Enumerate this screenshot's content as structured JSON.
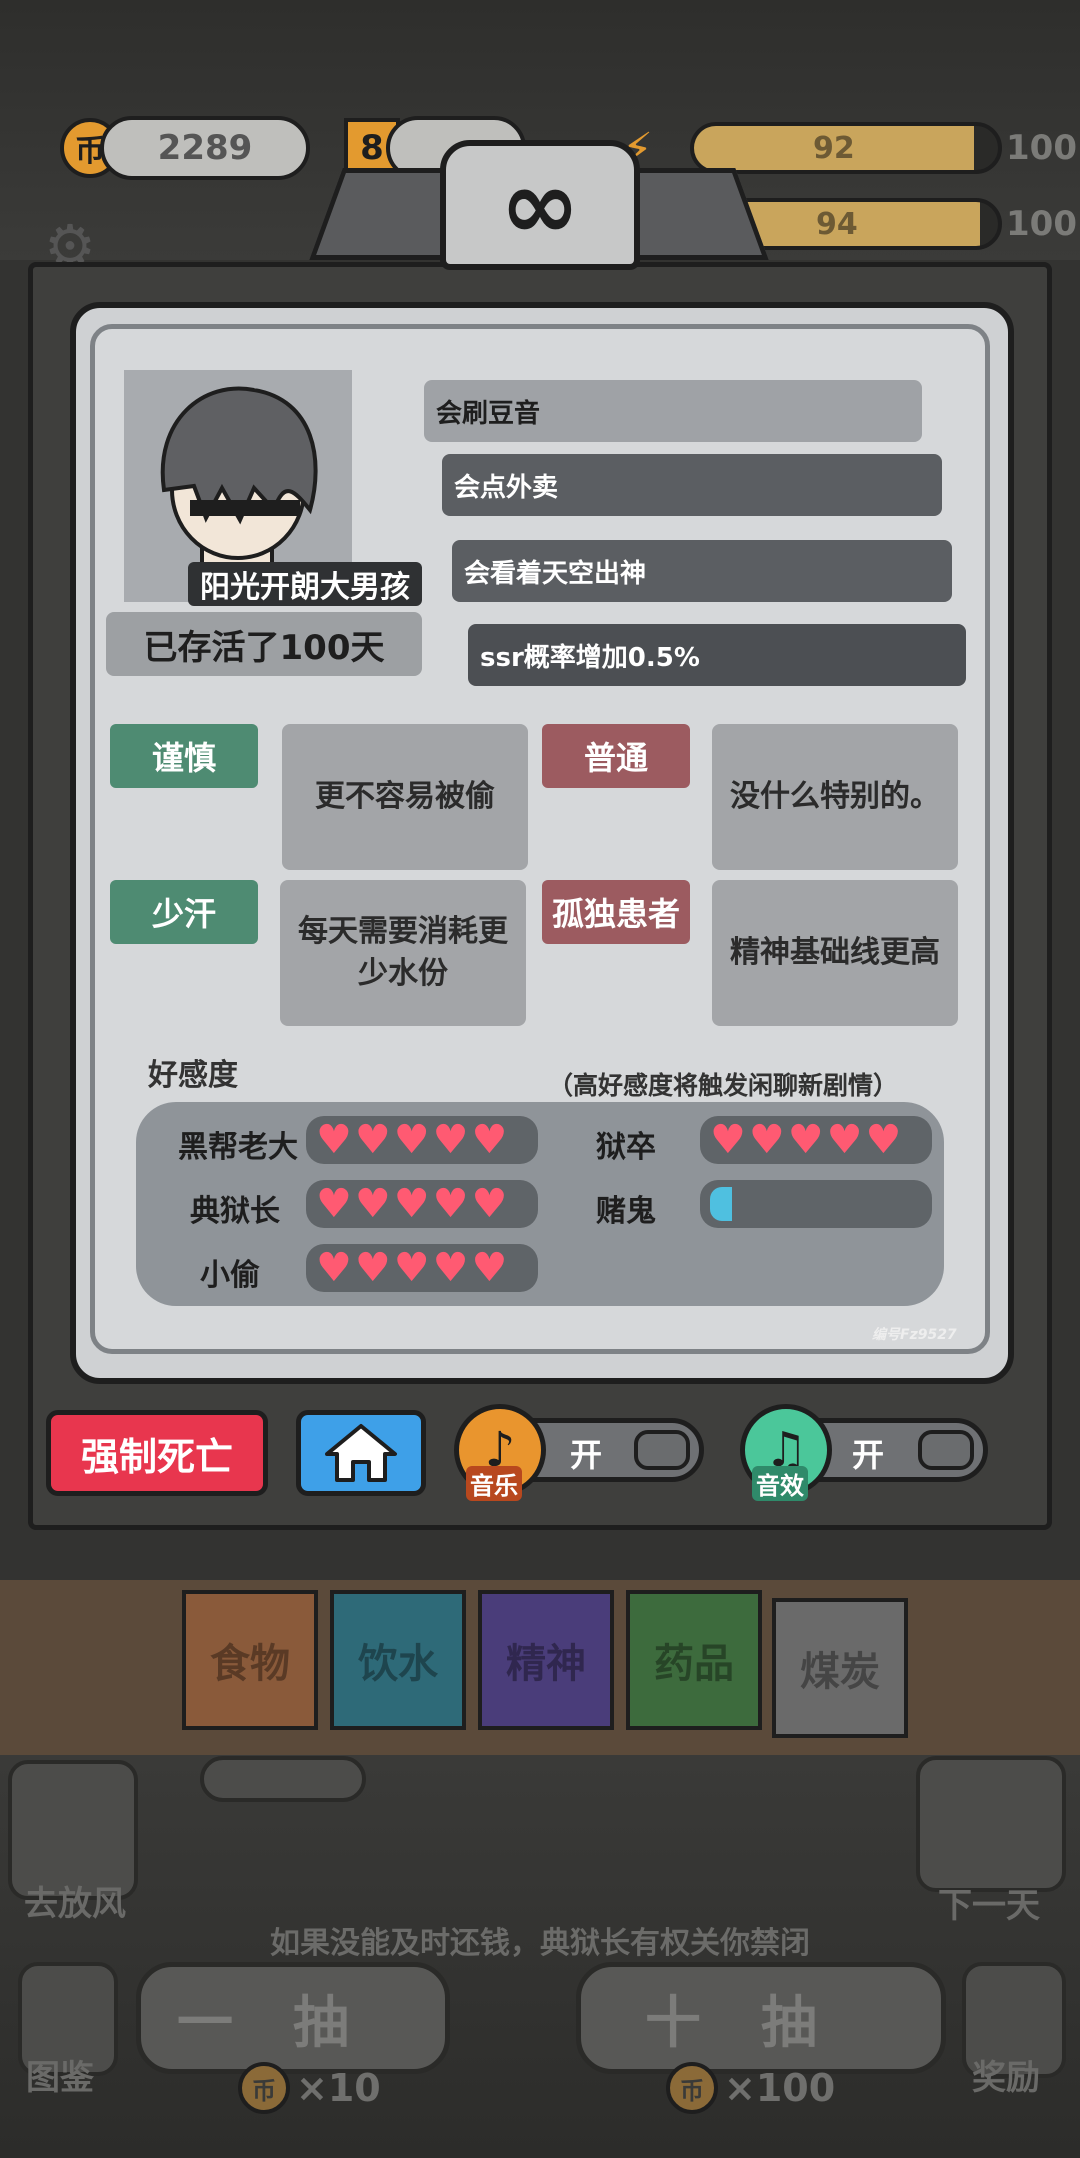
{
  "resources": {
    "coins": "2289",
    "s_value": "8",
    "energy": "92",
    "energy_max": "100",
    "water": "94",
    "water_max": "100",
    "coin_glyph": "币",
    "s_glyph": "S"
  },
  "profile": {
    "name": "阳光开朗大男孩",
    "days_alive": "已存活了100天",
    "taglines": [
      "会刷豆音",
      "会点外卖",
      "会看着天空出神",
      "ssr概率增加0.5%"
    ]
  },
  "traits": [
    {
      "label": "谨慎",
      "desc": "更不容易被偷",
      "color": "#4e8b72"
    },
    {
      "label": "普通",
      "desc": "没什么特别的。",
      "color": "#9c5b60"
    },
    {
      "label": "少汗",
      "desc": "每天需要消耗更少水份",
      "color": "#4e8b72"
    },
    {
      "label": "孤独患者",
      "desc": "精神基础线更高",
      "color": "#9c5b60"
    }
  ],
  "affection": {
    "title": "好感度",
    "note": "（高好感度将触发闲聊新剧情）",
    "characters": [
      {
        "name": "黑帮老大",
        "hearts": 5
      },
      {
        "name": "狱卒",
        "hearts": 5
      },
      {
        "name": "典狱长",
        "hearts": 5
      },
      {
        "name": "赌鬼",
        "hearts": 0.15
      },
      {
        "name": "小偷",
        "hearts": 5
      }
    ],
    "serial": "编号Fz9527"
  },
  "controls": {
    "force_death": "强制死亡",
    "music_label": "音乐",
    "music_state": "开",
    "sfx_label": "音效",
    "sfx_state": "开"
  },
  "categories": [
    "食物",
    "饮水",
    "精神",
    "药品",
    "煤炭"
  ],
  "category_colors": [
    "#8a5a3a",
    "#2e6a78",
    "#4a3d7a",
    "#3d6b3d",
    "#6a6a6a"
  ],
  "bottom": {
    "release": "去放风",
    "next_day": "下一天",
    "hint": "如果没能及时还钱，典狱长有权关你禁闭",
    "draw_one": "一抽",
    "draw_ten": "十抽",
    "cost_one": "×10",
    "cost_ten": "×100",
    "gallery": "图鉴",
    "reward": "奖励"
  }
}
